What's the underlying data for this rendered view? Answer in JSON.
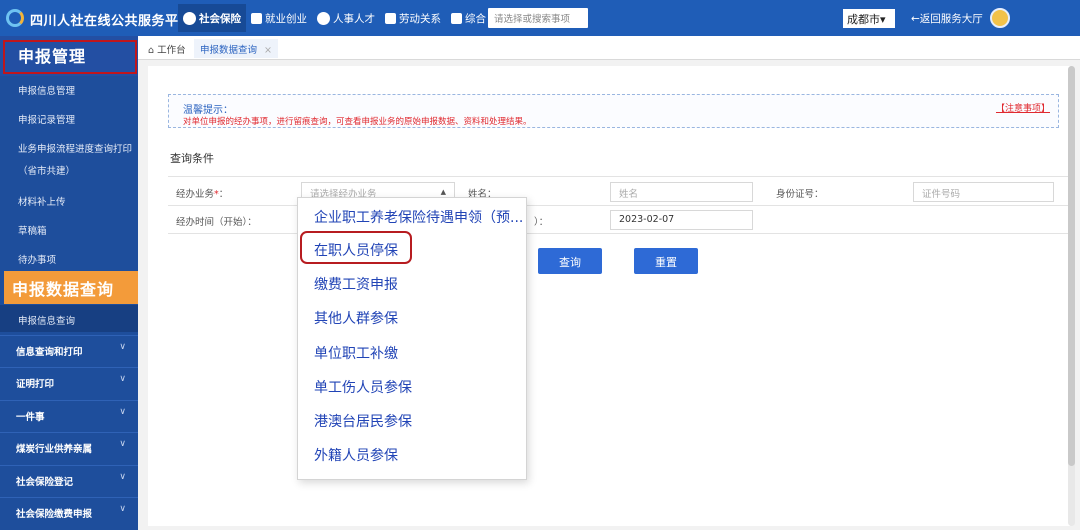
{
  "header": {
    "brand": "四川人社在线公共服务平台",
    "nav": [
      {
        "label": "社会保险",
        "active": true
      },
      {
        "label": "就业创业",
        "active": false
      },
      {
        "label": "人事人才",
        "active": false
      },
      {
        "label": "劳动关系",
        "active": false
      },
      {
        "label": "综合",
        "active": false
      }
    ],
    "search_placeholder": "请选择或搜索事项",
    "city": "成都市",
    "city_caret": "▾",
    "back_label": "←返回服务大厅"
  },
  "sidebar": {
    "title": "申报管理",
    "links": [
      "申报信息管理",
      "申报记录管理",
      "业务申报流程进度查询打印",
      "（省市共建）",
      "材料补上传",
      "草稿箱",
      "待办事项"
    ],
    "section_title": "申报数据查询",
    "section_sub": "申报信息查询",
    "groups": [
      "信息查询和打印",
      "证明打印",
      "一件事",
      "煤炭行业供养亲属",
      "社会保险登记",
      "社会保险缴费申报"
    ],
    "chevron": "∨"
  },
  "tabs": {
    "home": "工作台",
    "active": "申报数据查询",
    "close": "×"
  },
  "tip": {
    "title": "温馨提示：",
    "text": "对单位申报的经办事项，进行留痕查询，可查看申报业务的原始申报数据、资料和处理结果。",
    "link": "【注意事项】"
  },
  "query": {
    "section_label": "查询条件",
    "business_label": "经办业务",
    "business_required": "*",
    "business_colon": "：",
    "business_placeholder": "请选择经办业务",
    "name_label": "姓名：",
    "name_placeholder": "姓名",
    "id_label": "身份证号：",
    "id_placeholder": "证件号码",
    "time_start_label": "经办时间（开始）：",
    "time_end_label_fragment": "）：",
    "time_end_value": "2023-02-07",
    "search_button": "查询",
    "reset_button": "重置",
    "arrow": "▲"
  },
  "dropdown": {
    "options": [
      "企业职工养老保险待遇申领（预...",
      "在职人员停保",
      "缴费工资申报",
      "其他人群参保",
      "单位职工补缴",
      "单工伤人员参保",
      "港澳台居民参保",
      "外籍人员参保"
    ]
  },
  "colors": {
    "topbar": "#1f5db7",
    "sidebar": "#1e4e9c",
    "accent_orange": "#f39b3a",
    "highlight_red": "#c0161c",
    "button_blue": "#2e6ad6",
    "option_blue": "#2144b6"
  },
  "icons": {
    "logo": "app-logo",
    "social-insurance": "hand-shield-icon",
    "employment": "id-card-icon",
    "talent": "people-icon",
    "labor": "document-icon",
    "general": "layers-icon",
    "home": "home-icon",
    "avatar": "user-avatar"
  }
}
